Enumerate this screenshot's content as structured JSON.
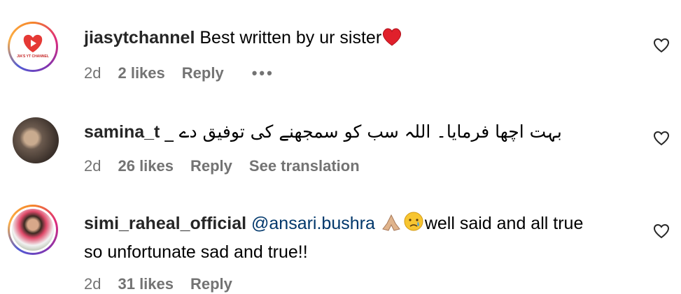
{
  "comments": [
    {
      "username": "jiasytchannel",
      "text": "Best written by ur sister",
      "time": "2d",
      "likes": "2 likes",
      "reply": "Reply",
      "more": "•••",
      "avatar_label": "JIA'S YT CHANNEL"
    },
    {
      "username": "samina_t",
      "text": "بہت اچھا فرمایا۔ اللہ سب کو سمجھنے کی توفیق دے _",
      "time": "2d",
      "likes": "26 likes",
      "reply": "Reply",
      "translate": "See translation"
    },
    {
      "username": "simi_raheal_official",
      "mention": "@ansari.bushra",
      "text1": "well said and all true",
      "text2": "so unfortunate sad and true!!",
      "time": "2d",
      "likes": "31 likes",
      "reply": "Reply"
    }
  ],
  "icons": {
    "like": "heart-outline-icon",
    "emoji_heart": "red-heart",
    "emoji_pray": "folded-hands",
    "emoji_sad": "crying-face"
  }
}
